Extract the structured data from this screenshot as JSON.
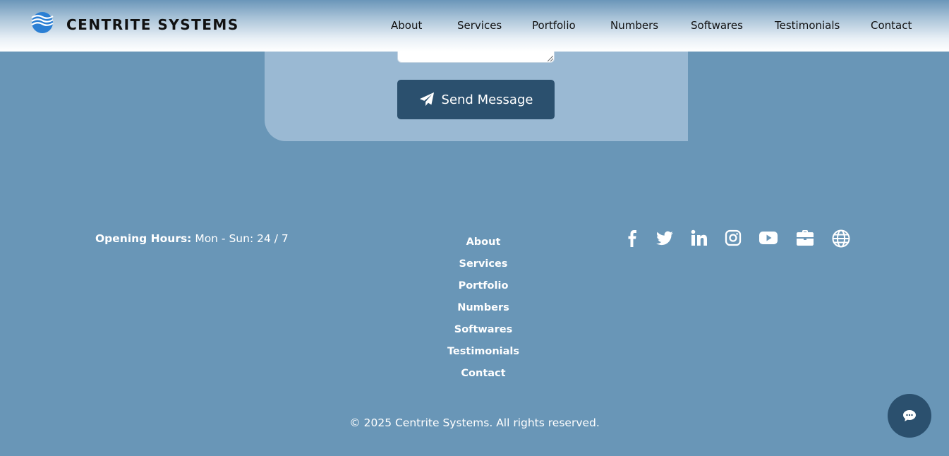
{
  "header": {
    "brand": "CENTRITE SYSTEMS",
    "nav": [
      "About",
      "Services",
      "Portfolio",
      "Numbers",
      "Softwares",
      "Testimonials",
      "Contact"
    ]
  },
  "form": {
    "send_label": "Send Message"
  },
  "footer": {
    "hours_label": "Opening Hours:",
    "hours_value": "Mon - Sun: 24 / 7",
    "links": [
      "About",
      "Services",
      "Portfolio",
      "Numbers",
      "Softwares",
      "Testimonials",
      "Contact"
    ],
    "social_icons": [
      "facebook-icon",
      "twitter-icon",
      "linkedin-icon",
      "instagram-icon",
      "youtube-icon",
      "briefcase-icon",
      "globe-icon"
    ],
    "copyright": "© 2025 Centrite Systems. All rights reserved."
  },
  "colors": {
    "background": "#6996b7",
    "card": "#9ab9d3",
    "button": "#2b506e",
    "logo_blue": "#2b7fd4"
  }
}
